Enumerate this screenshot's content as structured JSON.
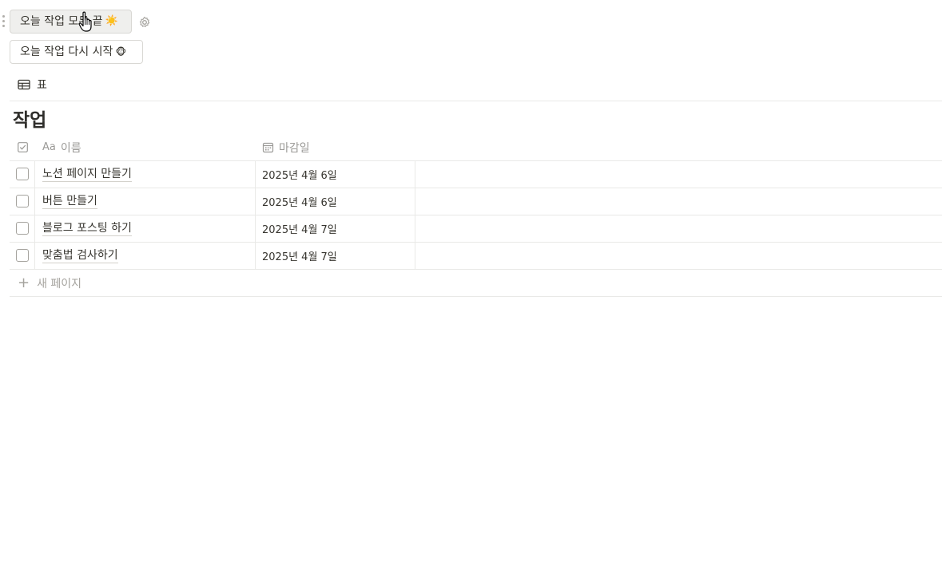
{
  "buttons": {
    "finish_label": "오늘 작업 모두 끝",
    "finish_emoji": "☀️",
    "restart_label": "오늘 작업 다시 시작",
    "restart_emoji": "🐵"
  },
  "view": {
    "tab_label": "표",
    "tab_icon": "table-icon"
  },
  "database": {
    "title": "작업",
    "columns": {
      "name": "이름",
      "name_icon_label": "Aa",
      "due": "마감일",
      "due_icon": "calendar-icon"
    },
    "rows": [
      {
        "name": "노션 페이지 만들기",
        "due": "2025년 4월 6일",
        "done": false
      },
      {
        "name": "버튼 만들기",
        "due": "2025년 4월 6일",
        "done": false
      },
      {
        "name": "블로그 포스팅 하기",
        "due": "2025년 4월 7일",
        "done": false
      },
      {
        "name": "맞춤법 검사하기",
        "due": "2025년 4월 7일",
        "done": false
      }
    ],
    "new_page_label": "새 페이지"
  },
  "colors": {
    "text": "#37352f",
    "muted": "#9b9a97",
    "border": "#e9e9e7",
    "button_hover": "#efefed"
  }
}
